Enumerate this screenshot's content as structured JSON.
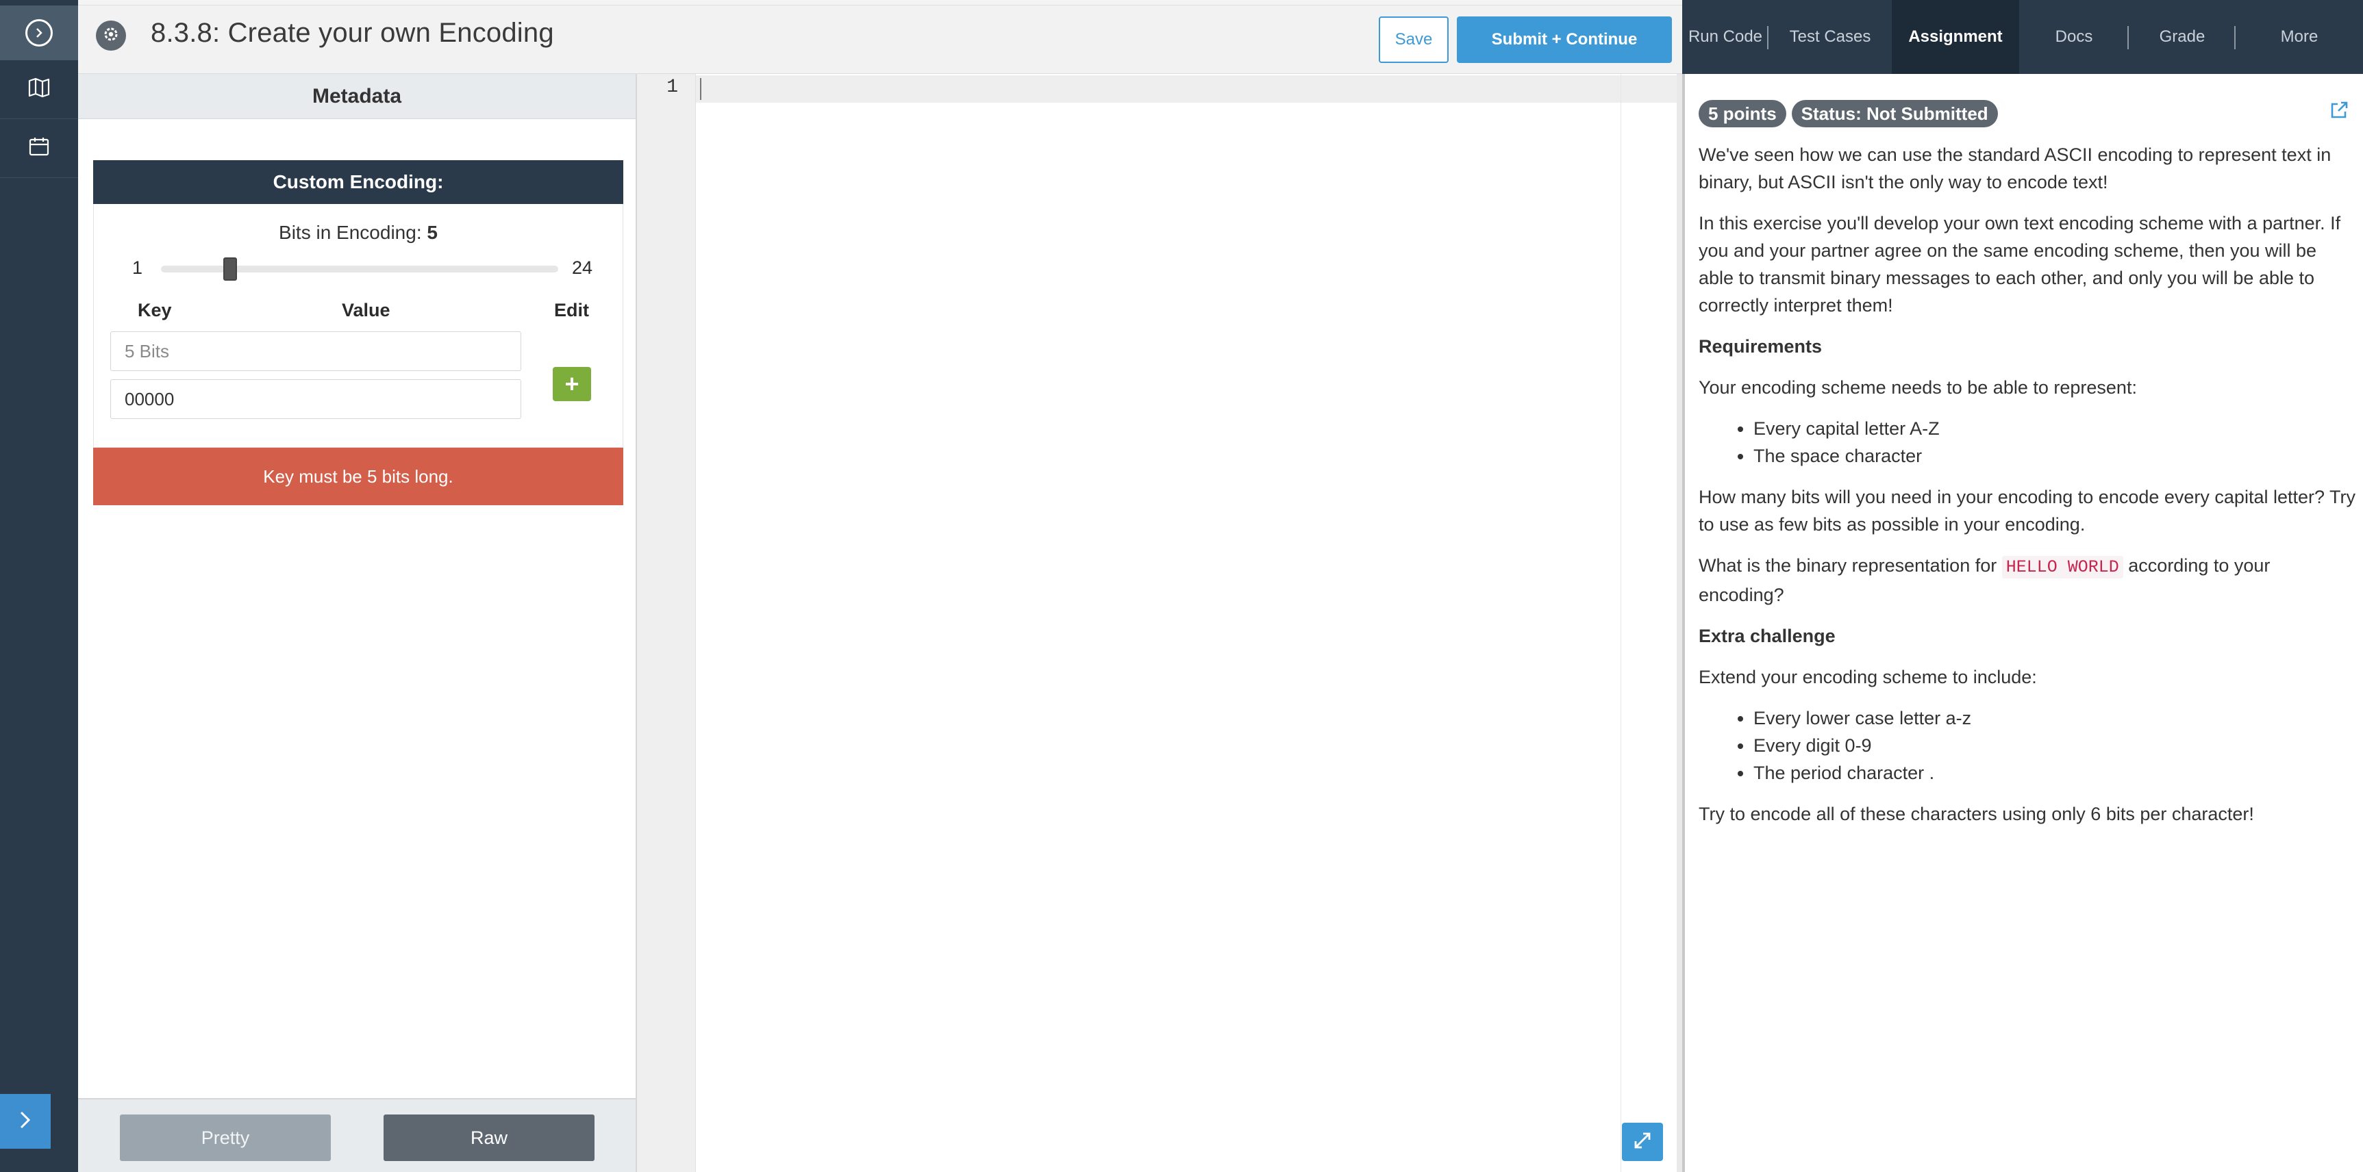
{
  "header": {
    "title": "8.3.8: Create your own Encoding",
    "save_label": "Save",
    "submit_label": "Submit + Continue"
  },
  "tabs": [
    {
      "label": "Run Code"
    },
    {
      "label": "Test Cases"
    },
    {
      "label": "Assignment",
      "active": true
    },
    {
      "label": "Docs"
    },
    {
      "label": "Grade"
    },
    {
      "label": "More"
    }
  ],
  "metadata": {
    "heading": "Metadata",
    "card_title": "Custom Encoding:",
    "bits_label": "Bits in Encoding:",
    "bits_value": "5",
    "slider_min": "1",
    "slider_max": "24",
    "slider_value": 5,
    "col_key": "Key",
    "col_value": "Value",
    "col_edit": "Edit",
    "key_placeholder": "5 Bits",
    "value_field": "00000",
    "add_symbol": "+",
    "error": "Key must be 5 bits long.",
    "pretty_label": "Pretty",
    "raw_label": "Raw"
  },
  "editor": {
    "line_number": "1"
  },
  "assignment": {
    "points": "5 points",
    "status": "Status: Not Submitted",
    "p1": "We've seen how we can use the standard ASCII encoding to represent text in binary, but ASCII isn't the only way to encode text!",
    "p2": "In this exercise you'll develop your own text encoding scheme with a partner. If you and your partner agree on the same encoding scheme, then you will be able to transmit binary messages to each other, and only you will be able to correctly interpret them!",
    "req_heading": "Requirements",
    "req_intro": "Your encoding scheme needs to be able to represent:",
    "req_items": [
      "Every capital letter A-Z",
      "The space character"
    ],
    "p3": "How many bits will you need in your encoding to encode every capital letter? Try to use as few bits as possible in your encoding.",
    "p4_before": "What is the binary representation for",
    "p4_code": "HELLO WORLD",
    "p4_after": "according to your encoding?",
    "extra_heading": "Extra challenge",
    "extra_intro": "Extend your encoding scheme to include:",
    "extra_items": [
      "Every lower case letter a-z",
      "Every digit 0-9",
      "The period character ."
    ],
    "p5": "Try to encode all of these characters using only 6 bits per character!"
  },
  "colors": {
    "rail": "#2a3a4a",
    "accent_blue": "#3e9ad6",
    "error_red": "#d35e4a",
    "add_green": "#7dae3c"
  },
  "icons": {
    "rail_top": "circle-chevron-right-icon",
    "rail_map": "map-icon",
    "rail_calendar": "calendar-icon",
    "rail_expand": "chevron-right-icon",
    "header_gear": "gear-icon",
    "assignment_external": "external-link-icon",
    "editor_expand": "expand-icon"
  }
}
